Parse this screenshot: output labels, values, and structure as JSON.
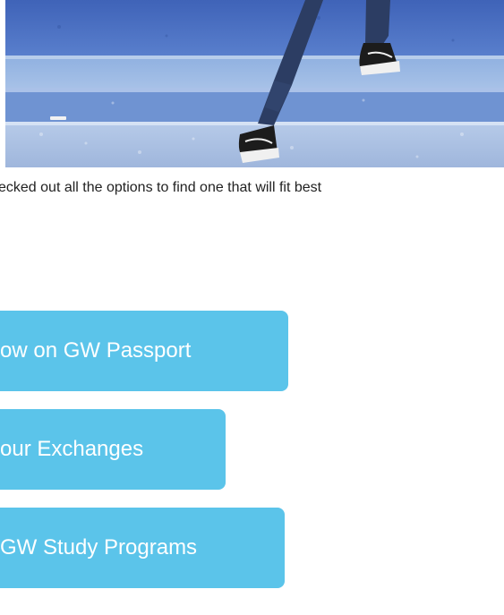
{
  "intro_text": "ecked out all the options to find one that will fit best",
  "buttons": [
    {
      "label": "ow on GW Passport"
    },
    {
      "label": "our Exchanges"
    },
    {
      "label": "GW Study Programs"
    }
  ],
  "colors": {
    "button_bg": "#5bc4ea",
    "button_text": "#ffffff",
    "body_text": "#222222"
  },
  "hero_image": {
    "icon": "photo-person-sitting-on-blue-steps"
  }
}
